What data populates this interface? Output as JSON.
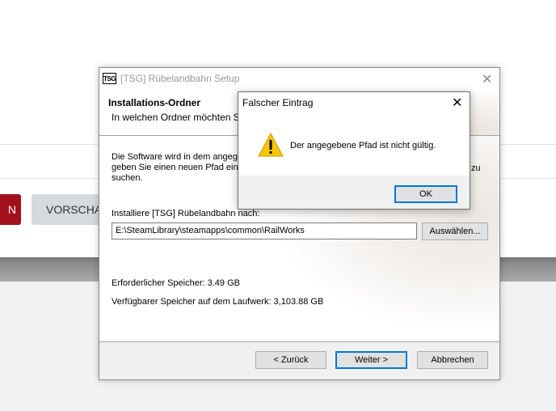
{
  "background_page": {
    "red_button_label": "N",
    "grey_button_label": "VORSCHAU"
  },
  "installer": {
    "logo_text": "TSG",
    "window_title": "[TSG] Rübelandbahn Setup",
    "close_glyph": "✕",
    "header_title": "Installations-Ordner",
    "header_subtitle": "In welchen Ordner möchten Sie [T",
    "description_line1": "Die Software wird in dem angegeb",
    "description_line2": "geben Sie einen neuen Pfad ein o",
    "description_line3": "suchen.",
    "description_right": "zu",
    "install_label": "Installiere [TSG] Rübelandbahn nach:",
    "install_path": "E:\\SteamLibrary\\steamapps\\common\\RailWorks",
    "browse_button": "Auswählen...",
    "required_space": "Erforderlicher Speicher: 3.49 GB",
    "available_space": "Verfügbarer Speicher auf dem Laufwerk: 3,103.88 GB",
    "back_button": "< Zurück",
    "next_button": "Weiter >",
    "cancel_button": "Abbrechen"
  },
  "error_dialog": {
    "title": "Falscher Eintrag",
    "close_glyph": "✕",
    "icon": "warning-icon",
    "message": "Der angegebene Pfad ist nicht gültig.",
    "ok_button": "OK"
  }
}
